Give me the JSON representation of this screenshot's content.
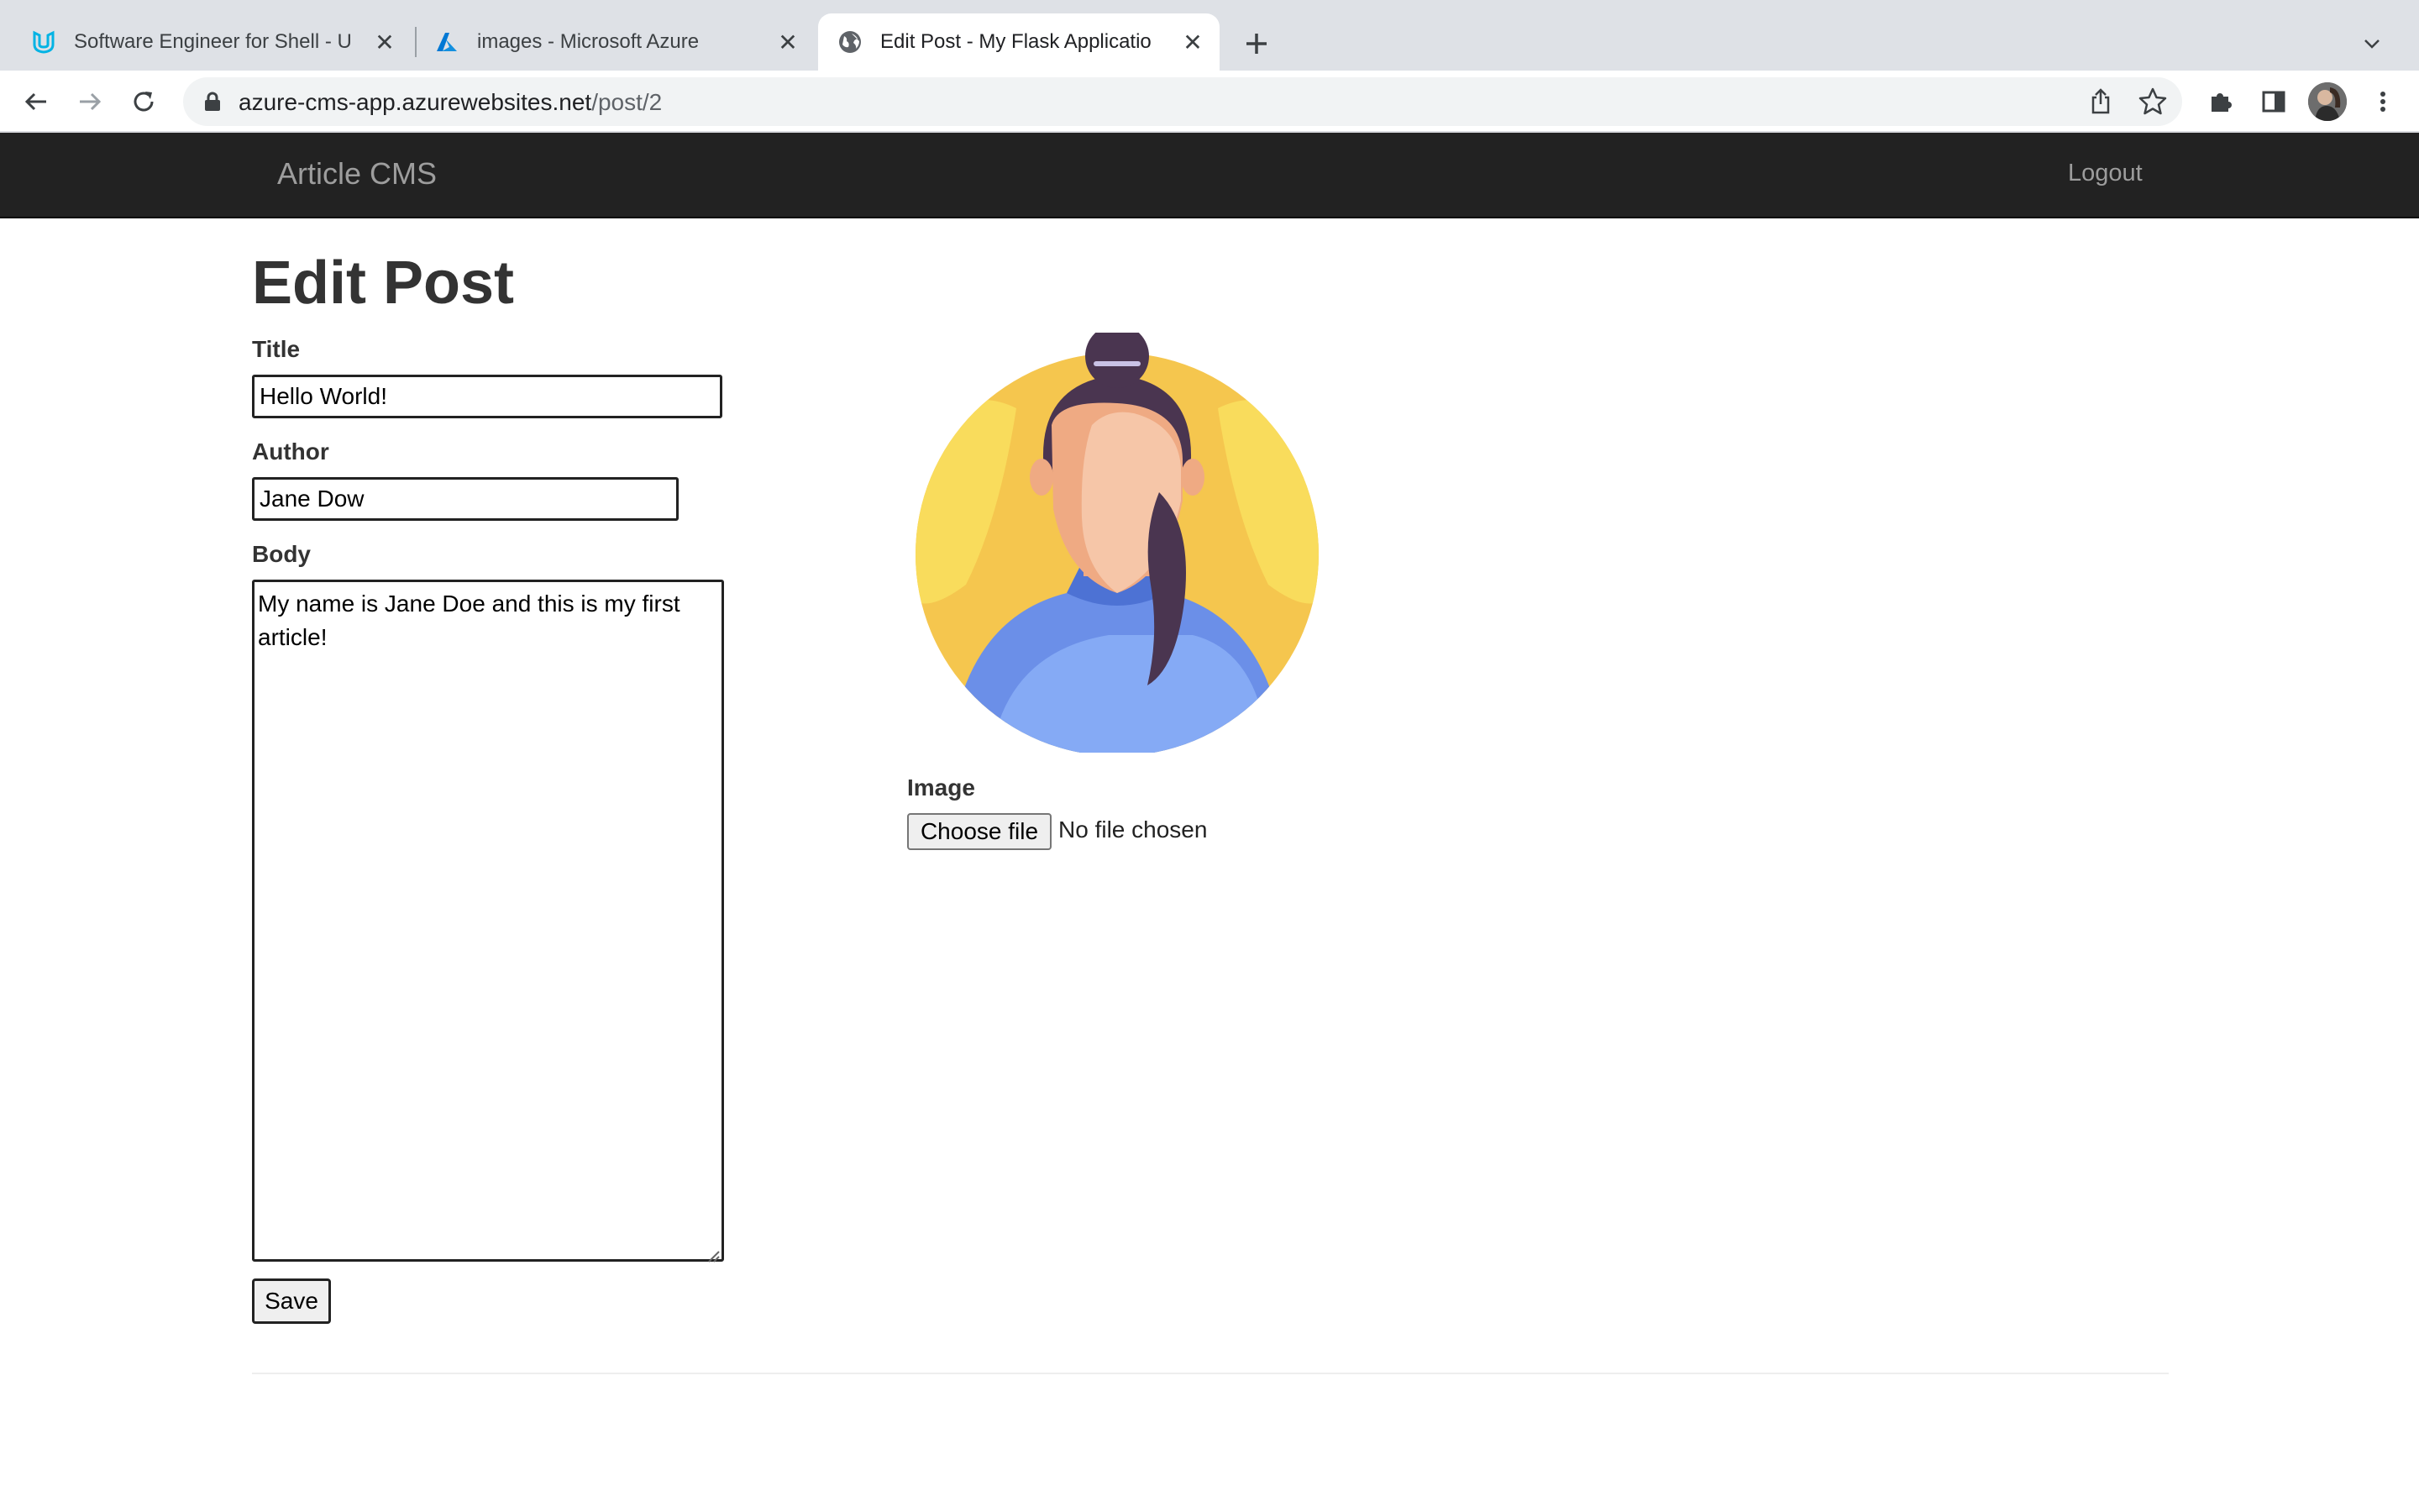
{
  "browser": {
    "tabs": [
      {
        "title": "Software Engineer for Shell - U",
        "icon": "udacity-icon"
      },
      {
        "title": "images - Microsoft Azure",
        "icon": "azure-icon"
      },
      {
        "title": "Edit Post - My Flask Applicatio",
        "icon": "globe-icon",
        "active": true
      }
    ],
    "address": {
      "host": "azure-cms-app.azurewebsites.net",
      "path": "/post/2"
    }
  },
  "navbar": {
    "brand": "Article CMS",
    "logout": "Logout"
  },
  "form": {
    "heading": "Edit Post",
    "title_label": "Title",
    "title_value": "Hello World!",
    "author_label": "Author",
    "author_value": "Jane Dow",
    "body_label": "Body",
    "body_value": "My name is Jane Doe and this is my first article!",
    "image_label": "Image",
    "choose_file": "Choose file",
    "no_file": "No file chosen",
    "save": "Save"
  },
  "colors": {
    "navbar_bg": "#222222",
    "navbar_text": "#9d9d9d",
    "avatar_bg": "#f5c64e",
    "shirt": "#6b8fe8"
  }
}
